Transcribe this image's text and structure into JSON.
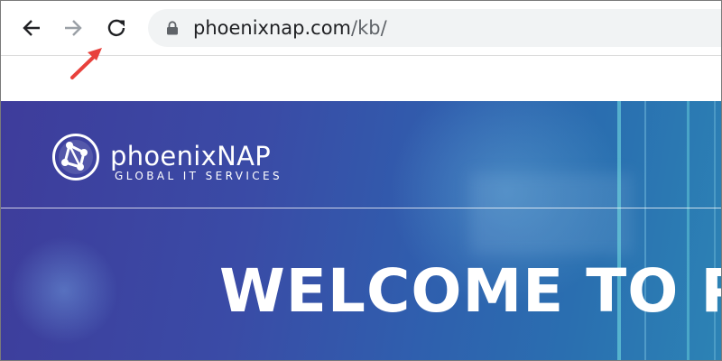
{
  "browser": {
    "url_host": "phoenixnap.com",
    "url_path": "/kb/"
  },
  "icons": {
    "back": "arrow-left-icon",
    "forward": "arrow-right-icon",
    "reload": "reload-icon",
    "lock": "lock-icon",
    "annotation": "red-pointer-arrow-icon"
  },
  "page": {
    "brand_name": "phoenixNAP",
    "brand_tagline": "GLOBAL IT SERVICES",
    "headline": "WELCOME TO P"
  },
  "colors": {
    "annotation_red": "#e8413c",
    "hero_start": "#3e3c9b",
    "hero_end": "#2c83b5"
  }
}
